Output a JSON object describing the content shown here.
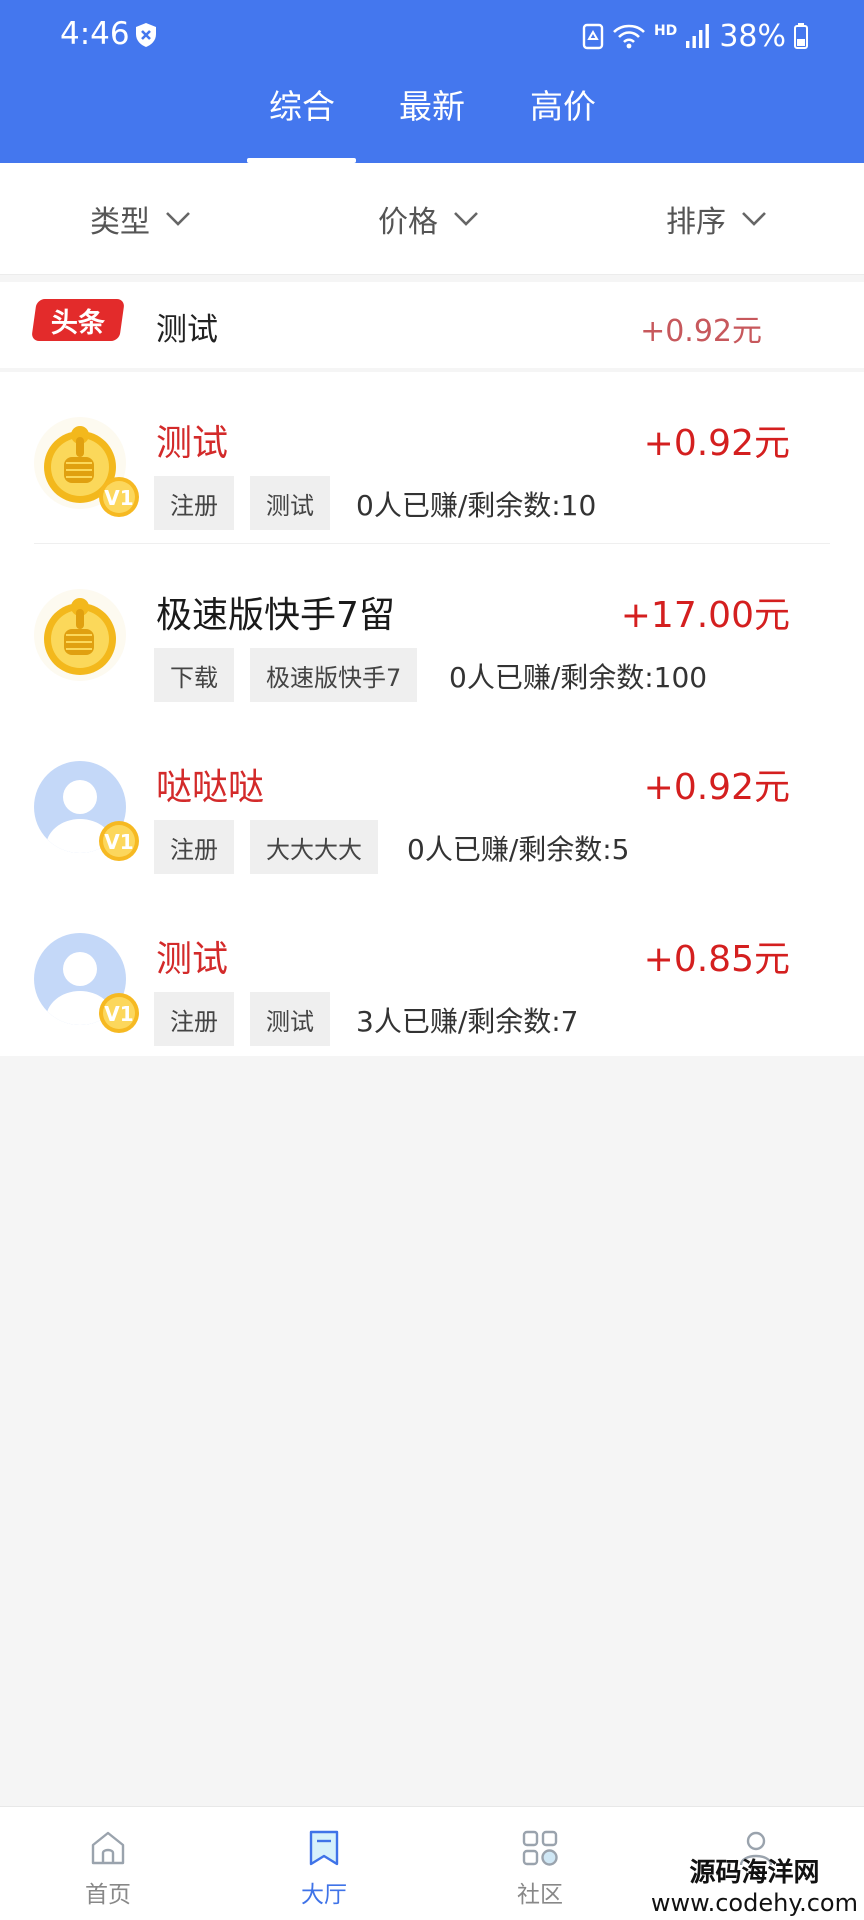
{
  "status_bar": {
    "time": "4:46",
    "network": "HD",
    "battery": "38%"
  },
  "tabs": [
    {
      "label": "综合",
      "active": true
    },
    {
      "label": "最新",
      "active": false
    },
    {
      "label": "高价",
      "active": false
    }
  ],
  "filters": [
    {
      "label": "类型"
    },
    {
      "label": "价格"
    },
    {
      "label": "排序"
    }
  ],
  "headline": {
    "badge": "头条",
    "title": "测试",
    "reward": "+0.92元"
  },
  "tasks": [
    {
      "title": "测试",
      "title_color": "red",
      "reward": "+0.92元",
      "tags": [
        "注册",
        "测试"
      ],
      "stats": "0人已赚/剩余数:10",
      "avatar": "thumbs-up-coin",
      "level": "V1"
    },
    {
      "title": "极速版快手7留",
      "title_color": "dark",
      "reward": "+17.00元",
      "tags": [
        "下载",
        "极速版快手7"
      ],
      "stats": "0人已赚/剩余数:100",
      "avatar": "thumbs-up-coin",
      "level": ""
    },
    {
      "title": "哒哒哒",
      "title_color": "red",
      "reward": "+0.92元",
      "tags": [
        "注册",
        "大大大大"
      ],
      "stats": "0人已赚/剩余数:5",
      "avatar": "default-user",
      "level": "V1"
    },
    {
      "title": "测试",
      "title_color": "red",
      "reward": "+0.85元",
      "tags": [
        "注册",
        "测试"
      ],
      "stats": "3人已赚/剩余数:7",
      "avatar": "default-user",
      "level": "V1"
    }
  ],
  "bottom_nav": [
    {
      "label": "首页",
      "icon": "home-icon",
      "active": false
    },
    {
      "label": "大厅",
      "icon": "hall-icon",
      "active": true
    },
    {
      "label": "社区",
      "icon": "grid-icon",
      "active": false
    },
    {
      "label": "",
      "icon": "profile-icon",
      "active": false
    }
  ],
  "watermark": {
    "line1": "源码海洋网",
    "line2": "www.codehy.com"
  },
  "colors": {
    "header_bg": "#4477ee",
    "reward_red": "#d41f1f",
    "title_red": "#d32a2a",
    "nav_active": "#3f73e8",
    "headline_badge": "#e32b2b"
  }
}
